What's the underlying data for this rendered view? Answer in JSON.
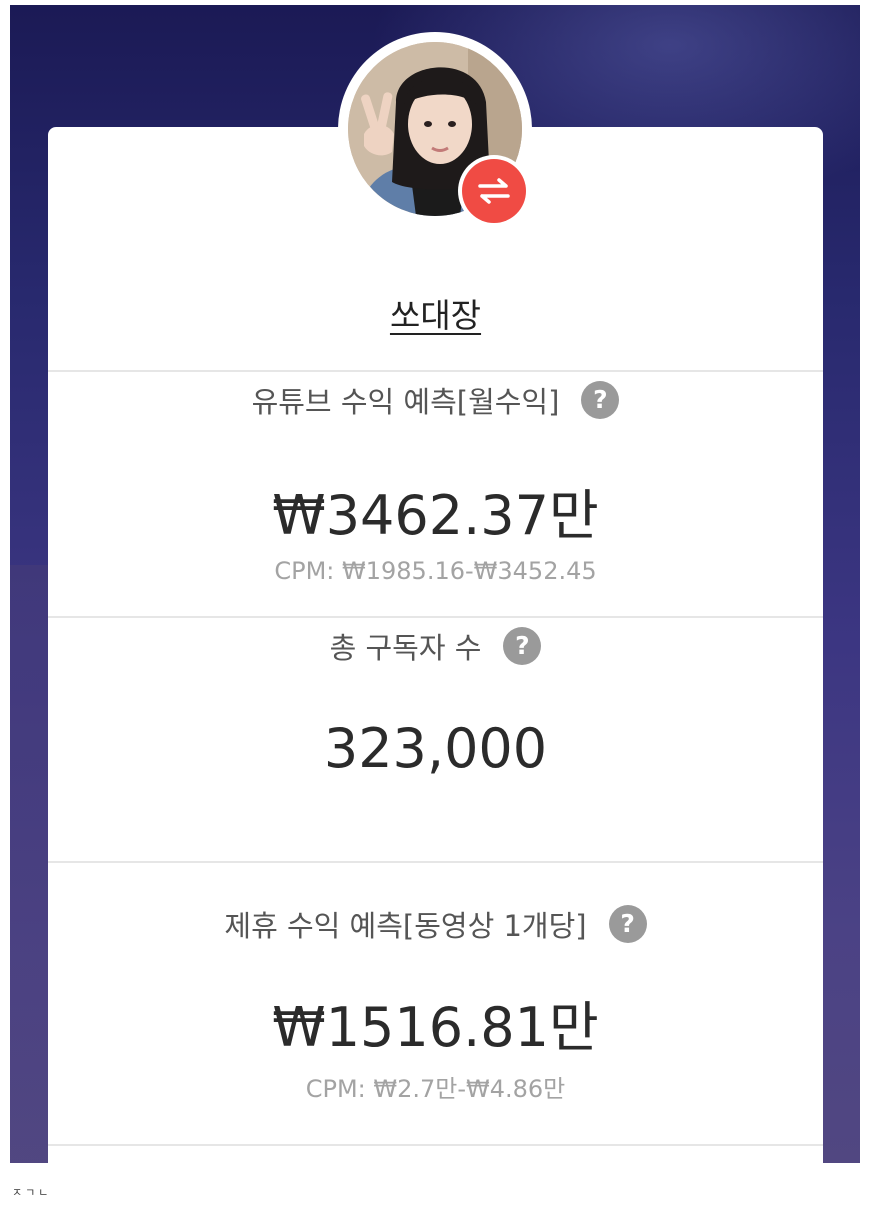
{
  "profile": {
    "channel_name": "쏘대장",
    "avatar_icon": "profile-photo",
    "swap_icon": "swap-arrows-icon",
    "swap_color": "#f04b44"
  },
  "sections": {
    "youtube_revenue": {
      "title": "유튜브 수익 예측[월수익]",
      "help": "?",
      "value": "₩3462.37만",
      "cpm": "CPM: ₩1985.16-₩3452.45"
    },
    "subscribers": {
      "title": "총 구독자 수",
      "help": "?",
      "value": "323,000"
    },
    "affiliate_revenue": {
      "title": "제휴 수익 예측[동영상 1개당]",
      "help": "?",
      "value": "₩1516.81만",
      "cpm": "CPM: ₩2.7만-₩4.86만"
    }
  },
  "caption": "ㅈㄱㄴ"
}
